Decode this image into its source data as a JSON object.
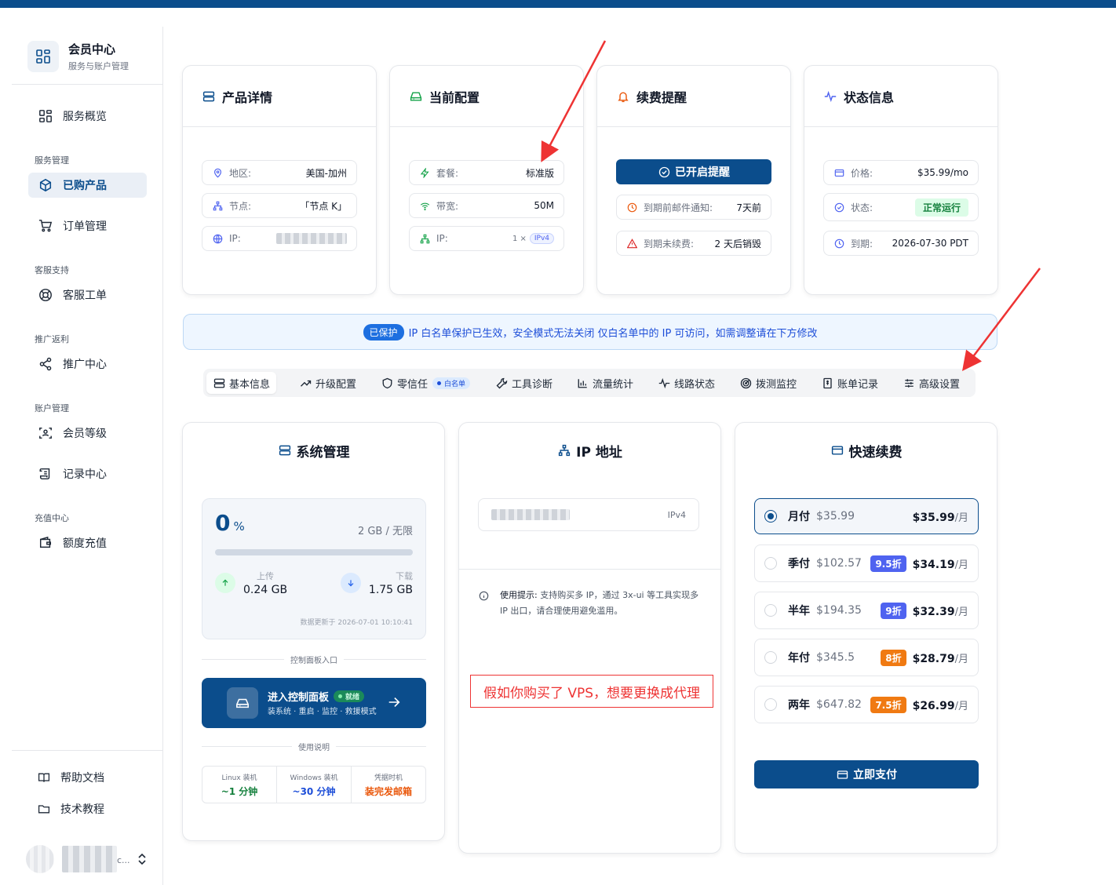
{
  "brand": {
    "title": "会员中心",
    "subtitle": "服务与账户管理"
  },
  "sidebar": {
    "overview": "服务概览",
    "groups": {
      "service": "服务管理",
      "support": "客服支持",
      "referral": "推广返利",
      "account": "账户管理",
      "recharge": "充值中心"
    },
    "items": {
      "products": "已购产品",
      "orders": "订单管理",
      "tickets": "客服工单",
      "promo": "推广中心",
      "level": "会员等级",
      "records": "记录中心",
      "topup": "额度充值"
    },
    "footer": {
      "help": "帮助文档",
      "tutorial": "技术教程"
    },
    "user": {
      "name_suffix": "c..."
    }
  },
  "cards": {
    "product": {
      "title": "产品详情",
      "region_label": "地区:",
      "region_value": "美国-加州",
      "node_label": "节点:",
      "node_value": "「节点 K」",
      "ip_label": "IP:"
    },
    "config": {
      "title": "当前配置",
      "plan_label": "套餐:",
      "plan_value": "标准版",
      "bandwidth_label": "带宽:",
      "bandwidth_value": "50M",
      "ip_label": "IP:",
      "ip_count": "1 ×",
      "ip_type": "IPv4"
    },
    "renewal": {
      "title": "续费提醒",
      "button": "已开启提醒",
      "notify_label": "到期前邮件通知:",
      "notify_value": "7天前",
      "unpaid_label": "到期未续费:",
      "unpaid_value": "2 天后销毁"
    },
    "status": {
      "title": "状态信息",
      "price_label": "价格:",
      "price_value": "$35.99/mo",
      "state_label": "状态:",
      "state_value": "正常运行",
      "expiry_label": "到期:",
      "expiry_value": "2026-07-30 PDT"
    }
  },
  "banner": {
    "tag": "已保护",
    "text": "IP 白名单保护已生效，安全模式无法关闭  仅白名单中的 IP 可访问，如需调整请在下方修改"
  },
  "tabs": {
    "basic": "基本信息",
    "upgrade": "升级配置",
    "zerotrust": "零信任",
    "zerotrust_tag": "白名单",
    "tools": "工具诊断",
    "traffic": "流量统计",
    "route": "线路状态",
    "probe": "拨测监控",
    "bills": "账单记录",
    "advanced": "高级设置"
  },
  "system": {
    "title": "系统管理",
    "usage_percent": "0",
    "percent_sign": "%",
    "usage_fraction": 0,
    "quota": "2 GB / 无限",
    "upload_label": "上传",
    "upload_value": "0.24 GB",
    "download_label": "下载",
    "download_value": "1.75 GB",
    "updated": "数据更新于 2026-07-01 10:10:41",
    "panel_entry": "控制面板入口",
    "panel_button": "进入控制面板",
    "panel_ready": "就绪",
    "panel_sub": "装系统 · 重启 · 监控 · 救援模式",
    "usage_notes": "使用说明",
    "stats": [
      {
        "label": "Linux 装机",
        "value": "~1 分钟",
        "color": "#15803d"
      },
      {
        "label": "Windows 装机",
        "value": "~30 分钟",
        "color": "#1d4ed8"
      },
      {
        "label": "凭据时机",
        "value": "装完发邮箱",
        "color": "#ea580c"
      }
    ]
  },
  "ip": {
    "title": "IP 地址",
    "type": "IPv4",
    "tip_label": "使用提示:",
    "tip_text": "支持购买多 IP，通过 3x-ui 等工具实现多 IP 出口，请合理使用避免滥用。"
  },
  "annotation": "假如你购买了 VPS，想要更换成代理",
  "renew": {
    "title": "快速续费",
    "pay_button": "立即支付",
    "unit": "/月",
    "plans": [
      {
        "name": "月付",
        "original": "$35.99",
        "discount": "",
        "price": "$35.99",
        "selected": true
      },
      {
        "name": "季付",
        "original": "$102.57",
        "discount": "9.5折",
        "price": "$34.19",
        "badge_color": "#4f63f0"
      },
      {
        "name": "半年",
        "original": "$194.35",
        "discount": "9折",
        "price": "$32.39",
        "badge_color": "#4f63f0"
      },
      {
        "name": "年付",
        "original": "$345.5",
        "discount": "8折",
        "price": "$28.79",
        "badge_color": "#f07a12"
      },
      {
        "name": "两年",
        "original": "$647.82",
        "discount": "7.5折",
        "price": "$26.99",
        "badge_color": "#f07a12"
      }
    ]
  },
  "colors": {
    "primary": "#0b4d8c",
    "annotation": "#e33333",
    "success": "#15803d"
  }
}
